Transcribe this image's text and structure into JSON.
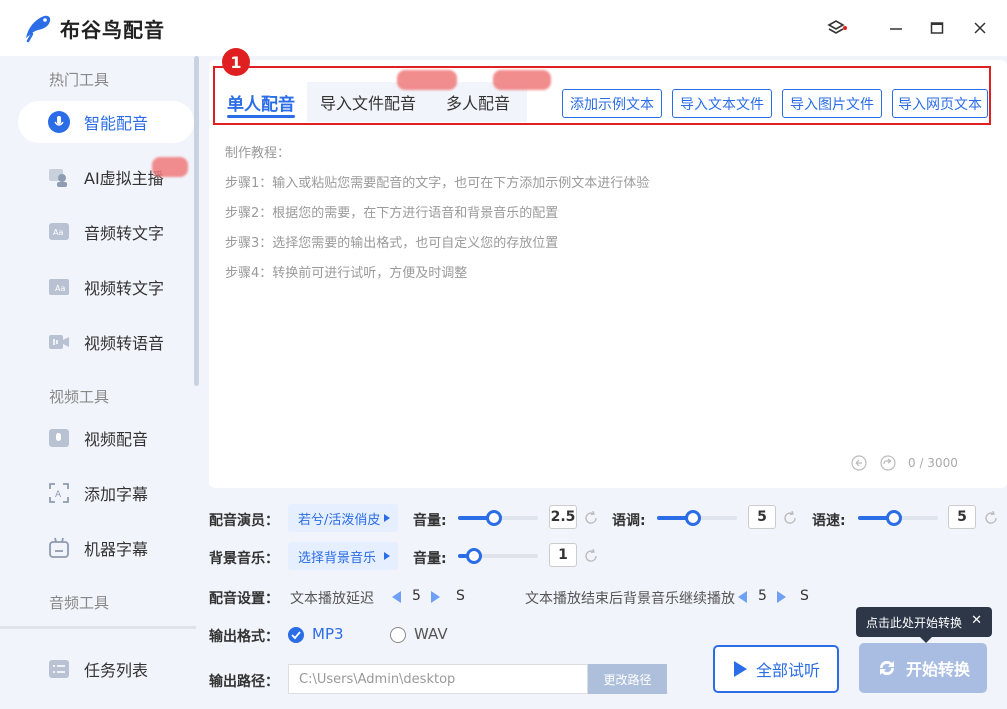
{
  "app": {
    "title": "布谷鸟配音"
  },
  "sidebar": {
    "sections": {
      "hot": "热门工具",
      "video": "视频工具",
      "audio": "音频工具"
    },
    "items": [
      {
        "label": "智能配音",
        "icon": "smart-dub-icon"
      },
      {
        "label": "AI虚拟主播",
        "icon": "virtual-anchor-icon"
      },
      {
        "label": "音频转文字",
        "icon": "audio-to-text-icon"
      },
      {
        "label": "视频转文字",
        "icon": "video-to-text-icon"
      },
      {
        "label": "视频转语音",
        "icon": "video-to-voice-icon"
      },
      {
        "label": "视频配音",
        "icon": "video-dub-icon"
      },
      {
        "label": "添加字幕",
        "icon": "add-subtitle-icon"
      },
      {
        "label": "机器字幕",
        "icon": "robot-subtitle-icon"
      }
    ],
    "task_list": "任务列表"
  },
  "annotation_badge": "1",
  "tabs": [
    "单人配音",
    "导入文件配音",
    "多人配音"
  ],
  "import_buttons": [
    "添加示例文本",
    "导入文本文件",
    "导入图片文件",
    "导入网页文本"
  ],
  "tutorial": [
    "制作教程：",
    "步骤1：输入或粘贴您需要配音的文字，也可在下方添加示例文本进行体验",
    "步骤2：根据您的需要，在下方进行语音和背景音乐的配置",
    "步骤3：选择您需要的输出格式，也可自定义您的存放位置",
    "步骤4：转换前可进行试听，方便及时调整"
  ],
  "counter": "0 / 3000",
  "voice": {
    "label": "配音演员：",
    "actor": "若兮/活泼俏皮",
    "volume_label": "音量:",
    "volume_value": "2.5",
    "volume_level": 0.45,
    "pitch_label": "语调:",
    "pitch_value": "5",
    "pitch_level": 0.45,
    "speed_label": "语速:",
    "speed_value": "5",
    "speed_level": 0.45
  },
  "bgm": {
    "label": "背景音乐：",
    "select": "选择背景音乐",
    "volume_label": "音量:",
    "volume_value": "1",
    "volume_level": 0.2
  },
  "settings": {
    "label": "配音设置：",
    "delay_label": "文本播放延迟",
    "delay_value": "5",
    "delay_unit": "S",
    "continue_label": "文本播放结束后背景音乐继续播放",
    "continue_value": "5",
    "continue_unit": "S"
  },
  "format": {
    "label": "输出格式：",
    "options": [
      "MP3",
      "WAV"
    ],
    "selected": "MP3"
  },
  "output": {
    "label": "输出路径：",
    "path": "C:\\Users\\Admin\\desktop",
    "change_button": "更改路径"
  },
  "actions": {
    "preview": "全部试听",
    "convert": "开始转换",
    "tooltip": "点击此处开始转换"
  },
  "colors": {
    "accent": "#2b6de6",
    "highlight": "#e02020",
    "sidebar_bg": "#f1f4fa"
  }
}
